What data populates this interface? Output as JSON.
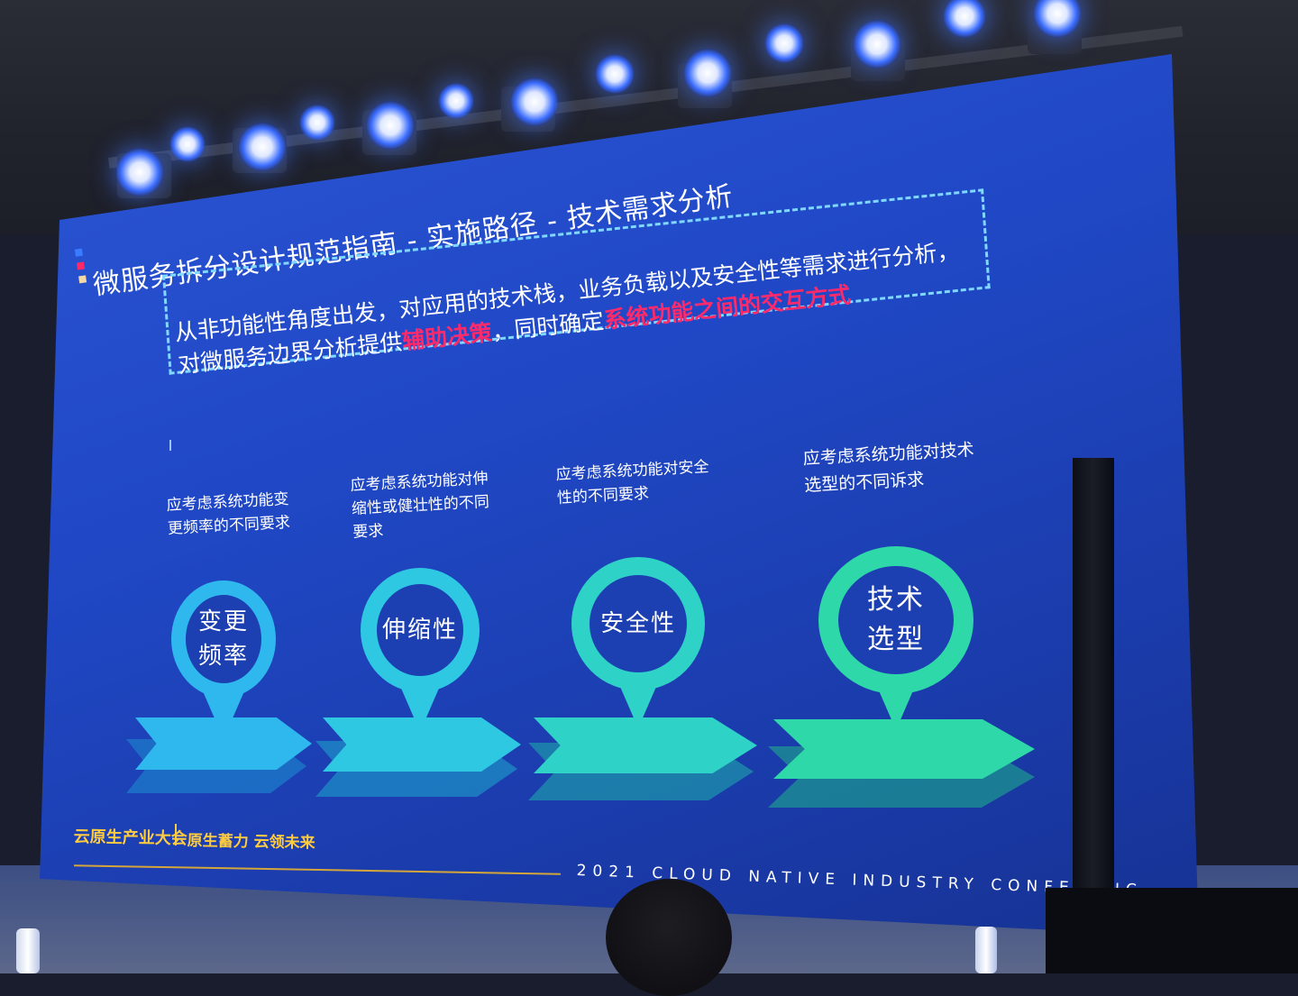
{
  "slide": {
    "title": "微服务拆分设计规范指南 - 实施路径 - 技术需求分析",
    "title_marks": [
      "#3b7bff",
      "#ff2a6a",
      "#f2d9a6"
    ],
    "callout": {
      "line1": "从非功能性角度出发，对应用的技术栈，业务负载以及安全性等需求进行分析，",
      "line2_prefix": "对微服务边界分析提供",
      "line2_highlight1": "辅助决策",
      "line2_middle": "，同时确定",
      "line2_highlight2": "系统功能之间的交互方式"
    },
    "items": [
      {
        "desc": "应考虑系统功能变更频率的不同要求",
        "label_line1": "变更",
        "label_line2": "频率",
        "color": "#2fb8ee"
      },
      {
        "desc": "应考虑系统功能对伸缩性或健壮性的不同要求",
        "label_line1": "伸缩性",
        "label_line2": "",
        "color": "#2ec8e2"
      },
      {
        "desc": "应考虑系统功能对安全性的不同要求",
        "label_line1": "安全性",
        "label_line2": "",
        "color": "#2ed2c6"
      },
      {
        "desc": "应考虑系统功能对技术选型的不同诉求",
        "label_line1": "技术",
        "label_line2": "选型",
        "color": "#2ed8a8"
      }
    ],
    "footer": {
      "brand": "云原生产业大会",
      "slogan": "原生蓄力 云领未来",
      "conference": "2021 CLOUD NATIVE INDUSTRY CONFERENC"
    },
    "colors": {
      "highlight": "#ff2a6a",
      "brand": "#ffcc40",
      "screen": "#2048c6"
    }
  }
}
